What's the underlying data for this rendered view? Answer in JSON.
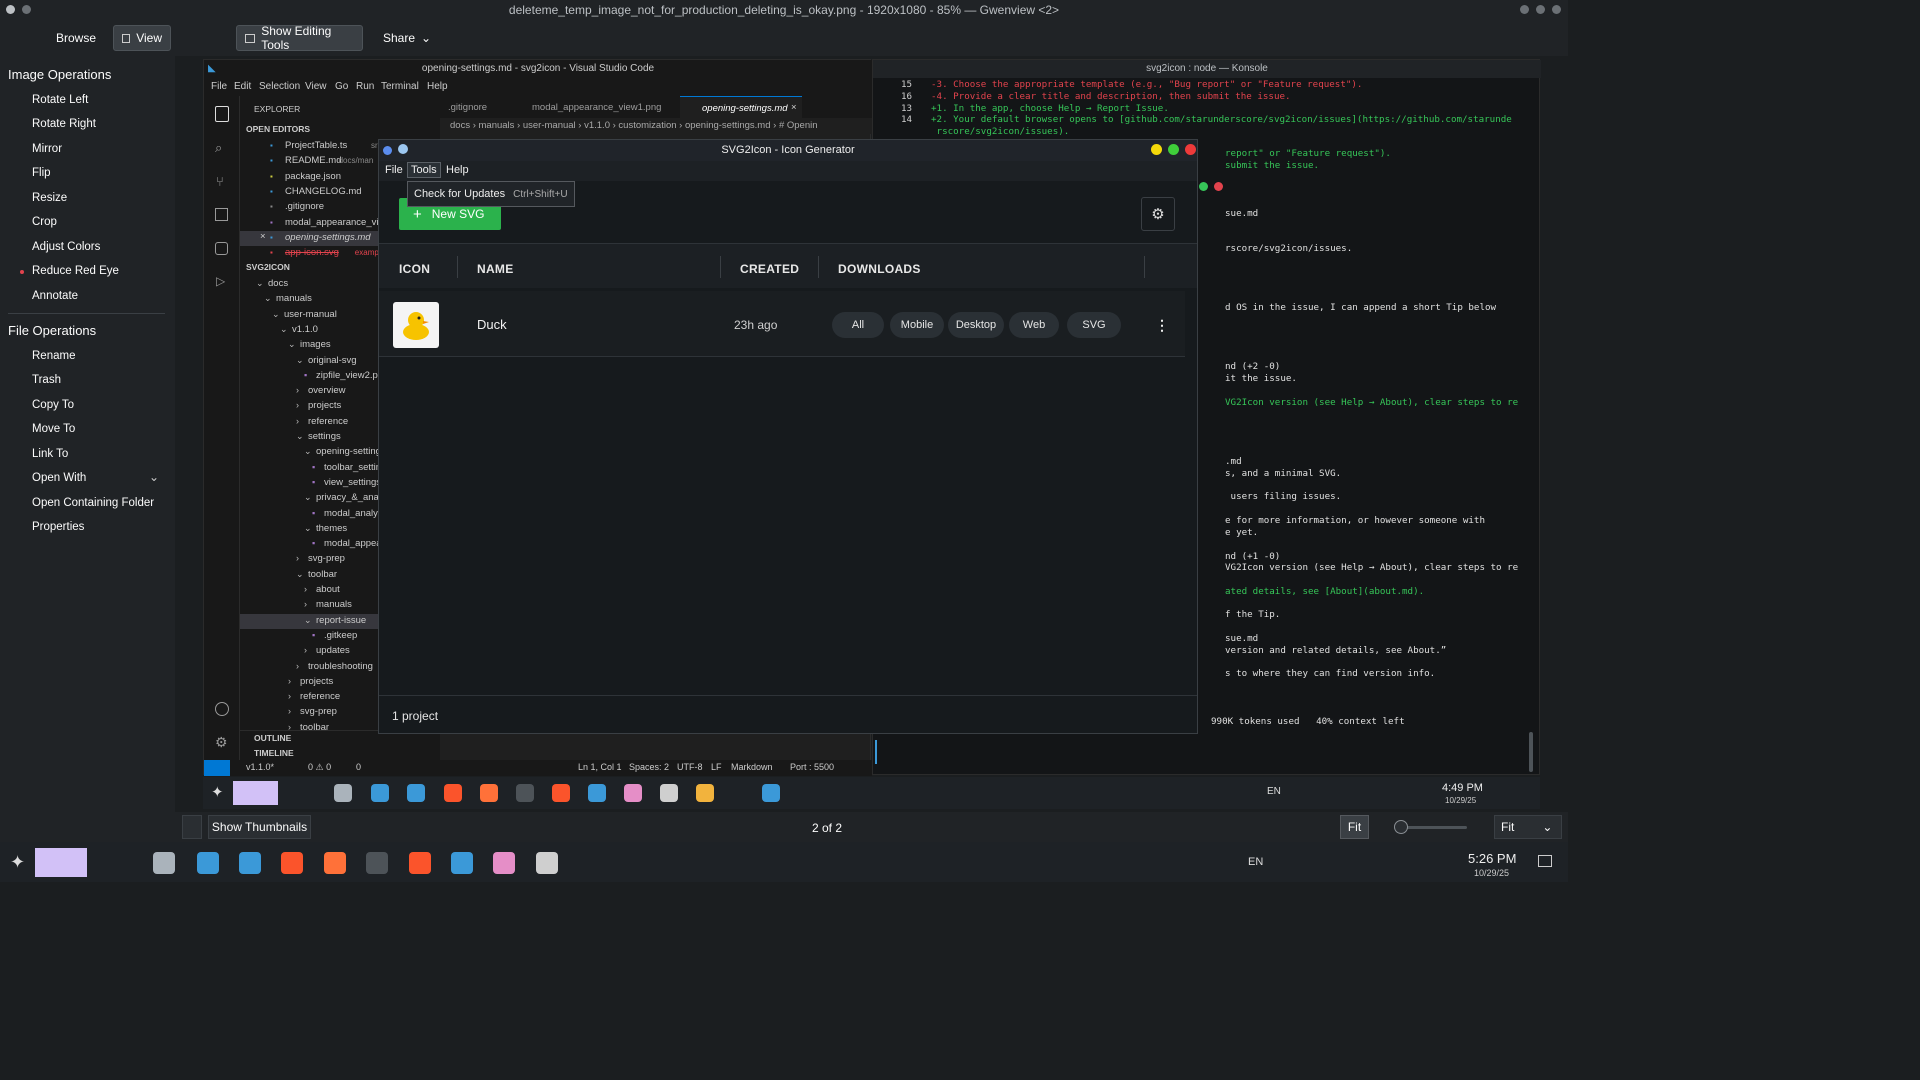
{
  "window": {
    "title": "deleteme_temp_image_not_for_production_deleting_is_okay.png - 1920x1080 - 85% — Gwenview <2>"
  },
  "toolbar": {
    "browse": "Browse",
    "view": "View",
    "show_editing_tools": "Show Editing Tools",
    "share": "Share"
  },
  "sidebar": {
    "image_ops_title": "Image Operations",
    "image_ops": [
      "Rotate Left",
      "Rotate Right",
      "Mirror",
      "Flip",
      "Resize",
      "Crop",
      "Adjust Colors",
      "Reduce Red Eye",
      "Annotate"
    ],
    "file_ops_title": "File Operations",
    "file_ops": [
      "Rename",
      "Trash",
      "Copy To",
      "Move To",
      "Link To",
      "Open With",
      "Open Containing Folder",
      "Properties"
    ]
  },
  "bottombar": {
    "show_thumbnails": "Show Thumbnails",
    "position": "2 of 2",
    "fit_button": "Fit",
    "fit_select": "Fit"
  },
  "taskbar": {
    "lang": "EN",
    "time": "5:26 PM",
    "date": "10/29/25"
  },
  "inner_taskbar": {
    "lang": "EN",
    "time": "4:49 PM",
    "date": "10/29/25"
  },
  "vscode": {
    "title": "opening-settings.md - svg2icon - Visual Studio Code",
    "menu": [
      "File",
      "Edit",
      "Selection",
      "View",
      "Go",
      "Run",
      "Terminal",
      "Help"
    ],
    "explorer": "EXPLORER",
    "open_editors": "OPEN EDITORS",
    "editors": [
      {
        "name": "ProjectTable.ts",
        "hint": "src/cor"
      },
      {
        "name": "README.md",
        "hint": "docs/man"
      },
      {
        "name": "package.json",
        "hint": ""
      },
      {
        "name": "CHANGELOG.md",
        "hint": ""
      },
      {
        "name": ".gitignore",
        "hint": ""
      },
      {
        "name": "modal_appearance_vi",
        "hint": ""
      },
      {
        "name": "opening-settings.md",
        "hint": "d"
      },
      {
        "name": "app-icon.svg",
        "hint": "example"
      }
    ],
    "project": "SVG2ICON",
    "tree": [
      "docs",
      "manuals",
      "user-manual",
      "v1.1.0",
      "images",
      "original-svg",
      "zipfile_view2.png",
      "overview",
      "projects",
      "reference",
      "settings",
      "opening-settings",
      "toolbar_settings_",
      "view_settings_but",
      "privacy_&_analytic",
      "modal_analytics_v",
      "themes",
      "modal_appearanc",
      "svg-prep",
      "toolbar",
      "about",
      "manuals",
      "report-issue",
      ".gitkeep",
      "updates",
      "troubleshooting",
      "projects",
      "reference",
      "svg-prep",
      "toolbar"
    ],
    "outline": "OUTLINE",
    "timeline": "TIMELINE",
    "tabs": [
      ".gitignore",
      "modal_appearance_view1.png",
      "opening-settings.md"
    ],
    "breadcrumb": "docs › manuals › user-manual › v1.1.0 › customization › opening-settings.md › # Openin",
    "status": {
      "branch": "v1.1.0*",
      "problems": "0 ⚠ 0",
      "ports": "0",
      "pos": "Ln 1, Col 1",
      "spaces": "Spaces: 2",
      "enc": "UTF-8",
      "eol": "LF",
      "lang": "Markdown",
      "port": "Port : 5500"
    }
  },
  "konsole": {
    "title": "svg2icon : node — Konsole",
    "lines": [
      {
        "n": "15",
        "t": "-3. Choose the appropriate template (e.g., \"Bug report\" or \"Feature request\").",
        "c": "red"
      },
      {
        "n": "16",
        "t": "-4. Provide a clear title and description, then submit the issue.",
        "c": "red"
      },
      {
        "n": "13",
        "t": "+1. In the app, choose Help → Report Issue.",
        "c": "green"
      },
      {
        "n": "14",
        "t": "+2. Your default browser opens to [github.com/starunderscore/svg2icon/issues](https://github.com/starunde",
        "c": "green"
      },
      {
        "n": "",
        "t": " rscore/svg2icon/issues).",
        "c": "green"
      }
    ],
    "right_lines": [
      {
        "t": "report\" or \"Feature request\").",
        "c": "green"
      },
      {
        "t": "submit the issue.",
        "c": "green"
      },
      {
        "t": "sue.md",
        "c": ""
      },
      {
        "t": "rscore/svg2icon/issues.",
        "c": ""
      },
      {
        "t": "d OS in the issue, I can append a short Tip below",
        "c": ""
      },
      {
        "t": "nd (+2 -0)",
        "c": ""
      },
      {
        "t": "it the issue.",
        "c": ""
      },
      {
        "t": "VG2Icon version (see Help → About), clear steps to re",
        "c": "green"
      },
      {
        "t": ".md",
        "c": ""
      },
      {
        "t": "s, and a minimal SVG.",
        "c": ""
      },
      {
        "t": " users filing issues.",
        "c": ""
      },
      {
        "t": "e for more information, or however someone with",
        "c": ""
      },
      {
        "t": "e yet.",
        "c": ""
      },
      {
        "t": "nd (+1 -0)",
        "c": ""
      },
      {
        "t": "VG2Icon version (see Help → About), clear steps to re",
        "c": ""
      },
      {
        "t": "ated details, see [About](about.md).",
        "c": "green"
      },
      {
        "t": "f the Tip.",
        "c": ""
      },
      {
        "t": "sue.md",
        "c": ""
      },
      {
        "t": "version and related details, see About.”",
        "c": ""
      },
      {
        "t": "s to where they can find version info.",
        "c": ""
      },
      {
        "t": "990K tokens used   40% context left",
        "c": ""
      }
    ]
  },
  "app": {
    "title": "SVG2Icon - Icon Generator",
    "menu": [
      "File",
      "Tools",
      "Help"
    ],
    "tooltip": {
      "label": "Check for Updates",
      "shortcut": "Ctrl+Shift+U"
    },
    "new_button": "New SVG",
    "headers": [
      "ICON",
      "NAME",
      "CREATED",
      "DOWNLOADS"
    ],
    "row": {
      "name": "Duck",
      "created": "23h ago",
      "downloads": [
        "All",
        "Mobile",
        "Desktop",
        "Web",
        "SVG"
      ]
    },
    "footer": "1 project"
  }
}
